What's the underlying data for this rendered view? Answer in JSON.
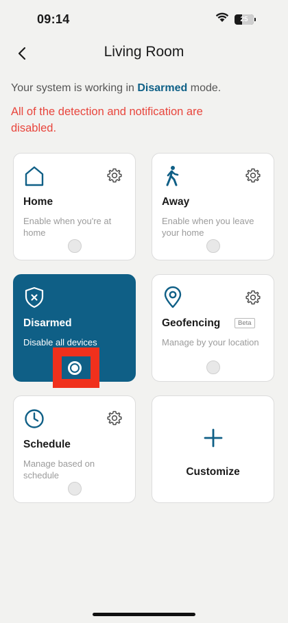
{
  "status_bar": {
    "time": "09:14",
    "battery": "25"
  },
  "header": {
    "title": "Living Room"
  },
  "status": {
    "prefix": "Your system is working in ",
    "mode": "Disarmed",
    "suffix": " mode.",
    "warning": "All of the detection and notification are disabled."
  },
  "modes": {
    "home": {
      "title": "Home",
      "desc": "Enable when you're at home",
      "icon": "home-icon",
      "selected": false
    },
    "away": {
      "title": "Away",
      "desc": "Enable when you leave your home",
      "icon": "walking-person-icon",
      "selected": false
    },
    "disarmed": {
      "title": "Disarmed",
      "desc": "Disable all devices",
      "icon": "shield-x-icon",
      "selected": true
    },
    "geofencing": {
      "title": "Geofencing",
      "badge": "Beta",
      "desc": "Manage by your location",
      "icon": "location-pin-icon",
      "selected": false
    },
    "schedule": {
      "title": "Schedule",
      "desc": "Manage based on schedule",
      "icon": "clock-icon",
      "selected": false
    }
  },
  "customize": {
    "label": "Customize",
    "icon": "plus-icon"
  },
  "colors": {
    "accent": "#0f5f86",
    "warning": "#e8453c",
    "highlight": "#f0301c",
    "background": "#f2f2f0"
  }
}
